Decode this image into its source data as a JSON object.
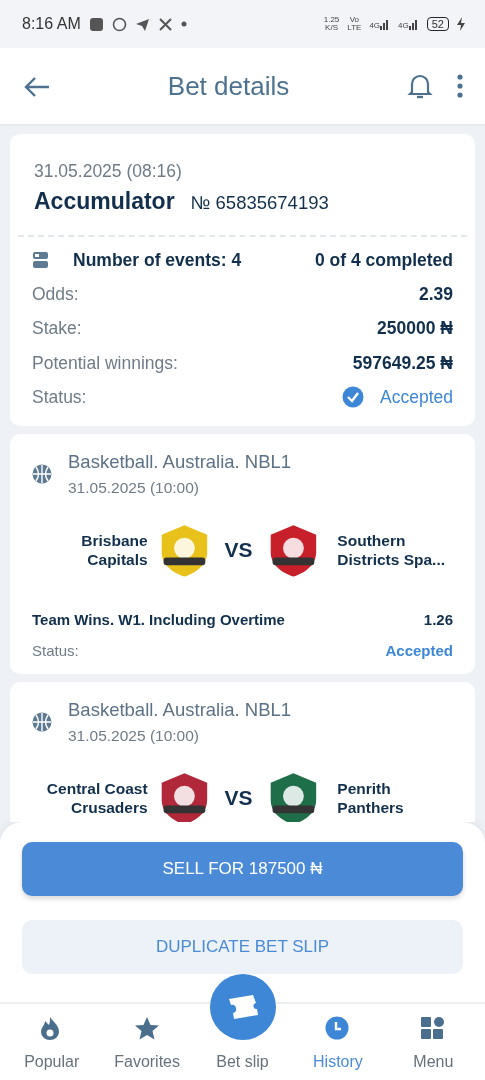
{
  "status_bar": {
    "time": "8:16 AM",
    "speed": "1.25",
    "speed_unit": "K/S",
    "volte_top": "Vo",
    "volte_bottom": "LTE",
    "signals": [
      "4G",
      "4G"
    ],
    "battery": "52"
  },
  "header": {
    "title": "Bet details"
  },
  "bet": {
    "date": "31.05.2025 (08:16)",
    "type": "Accumulator",
    "number": "№ 65835674193",
    "events_label": "Number of events: 4",
    "progress": "0 of 4 completed",
    "rows": [
      {
        "label": "Odds:",
        "value": "2.39"
      },
      {
        "label": "Stake:",
        "value": "250000 ₦"
      },
      {
        "label": "Potential winnings:",
        "value": "597649.25 ₦"
      }
    ],
    "status_label": "Status:",
    "status": "Accepted",
    "accepted": true
  },
  "events": [
    {
      "league": "Basketball. Australia. NBL1",
      "date": "31.05.2025 (10:00)",
      "home": "Brisbane Capitals",
      "away": "Southern Districts Spa...",
      "versus": "VS",
      "market": "Team Wins. W1. Including Overtime",
      "odds": "1.26",
      "status_label": "Status:",
      "status": "Accepted"
    },
    {
      "league": "Basketball. Australia. NBL1",
      "date": "31.05.2025 (10:00)",
      "home": "Central Coast Crusaders",
      "away": "Penrith Panthers",
      "versus": "VS"
    }
  ],
  "actions": [
    {
      "kind": "primary",
      "label": "SELL FOR 187500 ₦"
    },
    {
      "kind": "secondary",
      "label": "DUPLICATE BET SLIP"
    }
  ],
  "nav": [
    {
      "label": "Popular",
      "selected": false
    },
    {
      "label": "Favorites",
      "selected": false
    },
    {
      "label": "Bet slip",
      "selected": false
    },
    {
      "label": "History",
      "selected": true
    },
    {
      "label": "Menu",
      "selected": false
    }
  ]
}
